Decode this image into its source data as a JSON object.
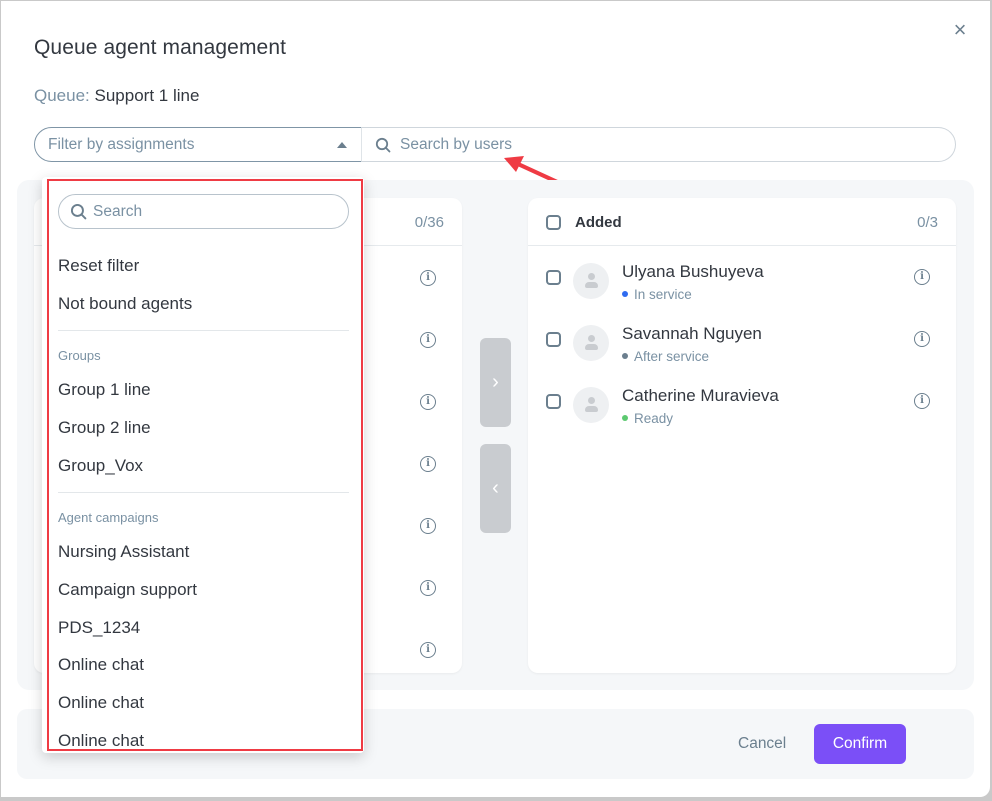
{
  "dialog": {
    "title": "Queue agent management",
    "close_icon": "×",
    "queue_label": "Queue:",
    "queue_value": "Support 1 line"
  },
  "filters": {
    "filter_placeholder": "Filter by assignments",
    "search_placeholder": "Search by users"
  },
  "available_panel": {
    "count": "0/36",
    "info_rows": 7
  },
  "added_panel": {
    "header": "Added",
    "count": "0/3",
    "agents": [
      {
        "name": "Ulyana Bushuyeva",
        "status": "In service",
        "status_color": "#2f6bf0"
      },
      {
        "name": "Savannah Nguyen",
        "status": "After service",
        "status_color": "#6b7f8e"
      },
      {
        "name": "Catherine Muravieva",
        "status": "Ready",
        "status_color": "#5cc970"
      }
    ]
  },
  "transfer": {
    "add_icon": "›",
    "remove_icon": "‹"
  },
  "dropdown": {
    "search_placeholder": "Search",
    "top_items": [
      "Reset filter",
      "Not bound agents"
    ],
    "groups_label": "Groups",
    "groups": [
      "Group 1 line",
      "Group 2 line",
      "Group_Vox"
    ],
    "campaigns_label": "Agent campaigns",
    "campaigns": [
      "Nursing Assistant",
      "Campaign support",
      "PDS_1234",
      "Online chat",
      "Online chat",
      "Online chat"
    ]
  },
  "footer": {
    "cancel_label": "Cancel",
    "confirm_label": "Confirm"
  },
  "colors": {
    "accent": "#7b4ff7",
    "highlight": "#ef3b44"
  }
}
